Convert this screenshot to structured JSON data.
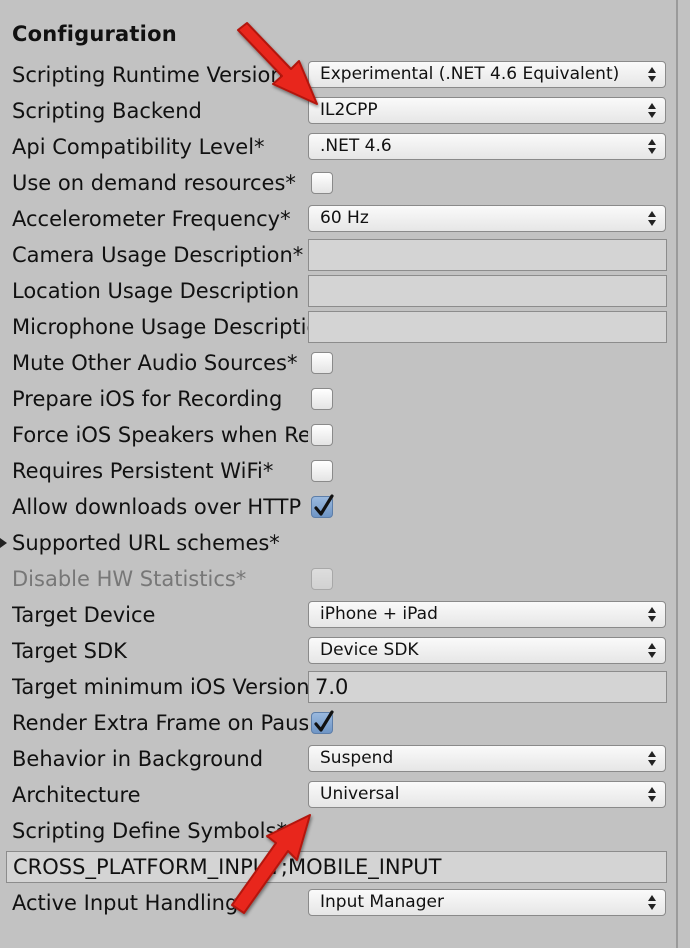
{
  "section_title": "Configuration",
  "rows": {
    "runtime": {
      "label": "Scripting Runtime Version*",
      "value": "Experimental (.NET 4.6 Equivalent)"
    },
    "backend": {
      "label": "Scripting Backend",
      "value": "IL2CPP"
    },
    "api": {
      "label": "Api Compatibility Level*",
      "value": ".NET 4.6"
    },
    "on_demand": {
      "label": "Use on demand resources*",
      "checked": false
    },
    "accel": {
      "label": "Accelerometer Frequency*",
      "value": "60 Hz"
    },
    "camera": {
      "label": "Camera Usage Description*",
      "value": ""
    },
    "location": {
      "label": "Location Usage Description",
      "value": ""
    },
    "microphone": {
      "label": "Microphone Usage Description",
      "value": ""
    },
    "mute": {
      "label": "Mute Other Audio Sources*",
      "checked": false
    },
    "prepare": {
      "label": "Prepare iOS for Recording",
      "checked": false
    },
    "force_speakers": {
      "label": "Force iOS Speakers when Recording",
      "checked": false
    },
    "wifi": {
      "label": "Requires Persistent WiFi*",
      "checked": false
    },
    "http": {
      "label": "Allow downloads over HTTP",
      "checked": true
    },
    "url_schemes": {
      "label": "Supported URL schemes*"
    },
    "hw_stats": {
      "label": "Disable HW Statistics*",
      "checked": false
    },
    "target_device": {
      "label": "Target Device",
      "value": "iPhone + iPad"
    },
    "target_sdk": {
      "label": "Target SDK",
      "value": "Device SDK"
    },
    "min_ios": {
      "label": "Target minimum iOS Version",
      "value": "7.0"
    },
    "extra_frame": {
      "label": "Render Extra Frame on Pause",
      "checked": true
    },
    "background": {
      "label": "Behavior in Background",
      "value": "Suspend"
    },
    "architecture": {
      "label": "Architecture",
      "value": "Universal"
    },
    "define_symbols": {
      "label": "Scripting Define Symbols*",
      "value": "CROSS_PLATFORM_INPUT;MOBILE_INPUT"
    },
    "input_handling": {
      "label": "Active Input Handling*",
      "value": "Input Manager"
    }
  },
  "icons": {
    "dropdown": "updown-arrows-icon",
    "check": "checkmark-icon",
    "foldout": "foldout-triangle-icon",
    "annotation": "red-arrow-icon"
  },
  "colors": {
    "panel": "#c2c2c2",
    "annotation_arrow": "#e8271d",
    "checked": "#7da1cd"
  }
}
